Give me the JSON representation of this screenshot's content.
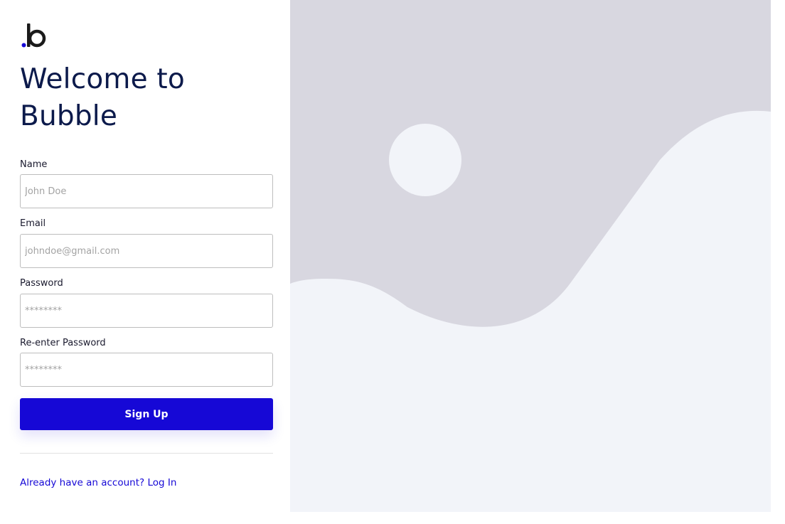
{
  "brand": {
    "logo_letter": "b",
    "logo_dot_color": "#1608d6",
    "logo_letter_color": "#1a1a1a"
  },
  "header": {
    "title": "Welcome to Bubble"
  },
  "form": {
    "name": {
      "label": "Name",
      "placeholder": "John Doe",
      "value": ""
    },
    "email": {
      "label": "Email",
      "placeholder": "johndoe@gmail.com",
      "value": ""
    },
    "password": {
      "label": "Password",
      "placeholder": "********",
      "value": ""
    },
    "confirm_password": {
      "label": "Re-enter Password",
      "placeholder": "********",
      "value": ""
    },
    "submit_label": "Sign Up"
  },
  "footer": {
    "login_link": "Already have an account? Log In"
  },
  "hero": {
    "icon": "image-placeholder-icon",
    "background_color": "#f2f4f9",
    "shape_color": "#d8d7e0"
  },
  "colors": {
    "accent": "#1608d6",
    "title": "#0c1a4b"
  }
}
